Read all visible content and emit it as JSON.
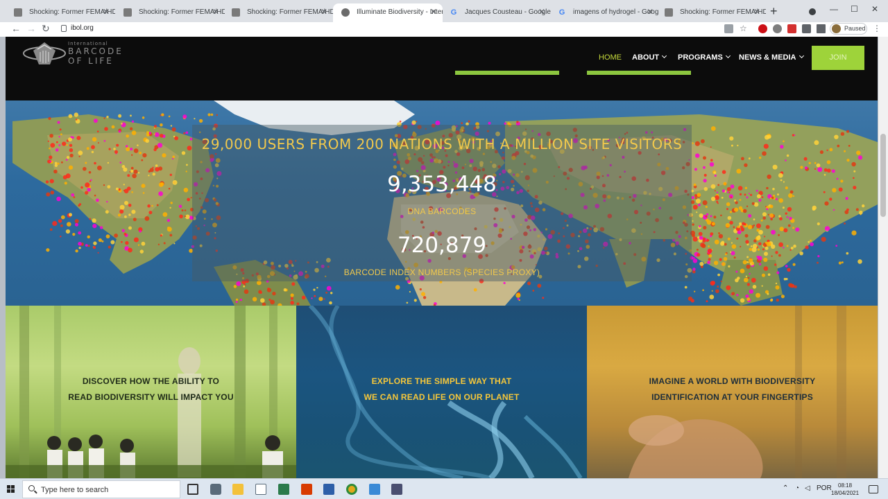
{
  "browser": {
    "tabs": [
      {
        "title": "Shocking: Former FEMA/HDS C",
        "icon": "page-icon"
      },
      {
        "title": "Shocking: Former FEMA/HDS C",
        "icon": "page-icon"
      },
      {
        "title": "Shocking: Former FEMA/HDS C",
        "icon": "page-icon"
      },
      {
        "title": "Illuminate Biodiversity - Interna",
        "icon": "ibol-icon",
        "active": true
      },
      {
        "title": "Jacques Cousteau - Google Sea",
        "icon": "google-icon"
      },
      {
        "title": "imagens of hydrogel - Google",
        "icon": "google-icon"
      },
      {
        "title": "Shocking: Former FEMA/HDS C",
        "icon": "page-icon"
      }
    ],
    "new_tab": "+",
    "url": "ibol.org",
    "profile_status": "Paused",
    "window_controls": {
      "minimize": "—",
      "maximize": "☐",
      "close": "✕"
    },
    "nav_glyphs": {
      "back": "←",
      "forward": "→",
      "reload": "↻"
    }
  },
  "site": {
    "logo": {
      "line1": "International",
      "line2": "BARCODE",
      "line3": "OF LIFE"
    },
    "nav": [
      {
        "label": "HOME",
        "active": true
      },
      {
        "label": "ABOUT",
        "dropdown": true
      },
      {
        "label": "PROGRAMS",
        "dropdown": true
      },
      {
        "label": "NEWS & MEDIA",
        "dropdown": true
      }
    ],
    "join_label": "JOIN",
    "accent_colors": {
      "nav_active": "#c8dc3c",
      "join": "#9ed33a",
      "stat_text": "#f2c94c"
    }
  },
  "stats": {
    "headline": "29,000 USERS FROM 200 NATIONS WITH A MILLION SITE VISITORS",
    "dna_barcodes_value": "9,353,448",
    "dna_barcodes_label": "DNA BARCODES",
    "bin_value": "720,879",
    "bin_label": "BARCODE INDEX NUMBERS (SPECIES PROXY)"
  },
  "tiles": [
    {
      "line1": "DISCOVER HOW THE ABILITY TO",
      "line2": "READ BIODIVERSITY WILL IMPACT YOU"
    },
    {
      "line1": "EXPLORE THE SIMPLE WAY THAT",
      "line2": "WE CAN READ LIFE ON OUR PLANET"
    },
    {
      "line1": "IMAGINE A WORLD WITH BIODIVERSITY",
      "line2": "IDENTIFICATION AT YOUR FINGERTIPS"
    }
  ],
  "taskbar": {
    "search_placeholder": "Type here to search",
    "language": "POR",
    "time": "08:18",
    "date": "18/04/2021"
  }
}
